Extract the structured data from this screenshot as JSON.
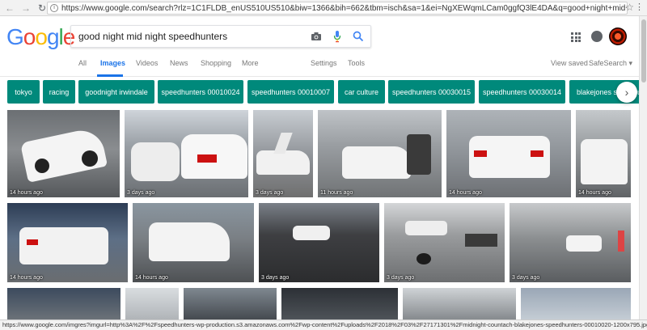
{
  "browser": {
    "url": "https://www.google.com/search?rlz=1C1FLDB_enUS510US510&biw=1366&bih=662&tbm=isch&sa=1&ei=NgXEWqmLCam0ggfQ3lE4DA&q=good+night+mid+night+speedhunters&oq=g...",
    "status_url": "https://www.google.com/imgres?imgurl=http%3A%2F%2Fspeedhunters-wp-production.s3.amazonaws.com%2Fwp-content%2Fuploads%2F2018%2F03%2F27171301%2Fmidnight-countach-blakejones-speedhunters-00010020-1200x795.jpg&imgrefurl..."
  },
  "logo": {
    "letters": [
      "G",
      "o",
      "o",
      "g",
      "l",
      "e"
    ],
    "colors": [
      "#4285F4",
      "#EA4335",
      "#FBBC05",
      "#4285F4",
      "#34A853",
      "#EA4335"
    ]
  },
  "search": {
    "query": "good night mid night speedhunters"
  },
  "tabs": [
    "All",
    "Images",
    "Videos",
    "News",
    "Shopping",
    "More"
  ],
  "tools": {
    "settings": "Settings",
    "tools": "Tools",
    "view_saved": "View saved",
    "safesearch": "SafeSearch ▾"
  },
  "chips": [
    "tokyo",
    "racing",
    "goodnight irwindale",
    "speedhunters 00010024",
    "speedhunters 00010007",
    "car culture",
    "speedhunters 00030015",
    "speedhunters 00030014",
    "blakejones speedhunters"
  ],
  "images": [
    {
      "ts": "14 hours ago"
    },
    {
      "ts": "3 days ago"
    },
    {
      "ts": "3 days ago"
    },
    {
      "ts": "11 hours ago"
    },
    {
      "ts": "14 hours ago"
    },
    {
      "ts": "14 hours ago"
    },
    {
      "ts": "14 hours ago"
    },
    {
      "ts": "14 hours ago"
    },
    {
      "ts": "3 days ago"
    },
    {
      "ts": "3 days ago"
    },
    {
      "ts": "3 days ago"
    },
    {
      "ts": ""
    },
    {
      "ts": ""
    },
    {
      "ts": ""
    },
    {
      "ts": ""
    },
    {
      "ts": ""
    },
    {
      "ts": ""
    }
  ],
  "colors": {
    "chip": "#00897b",
    "accent": "#1a73e8"
  }
}
